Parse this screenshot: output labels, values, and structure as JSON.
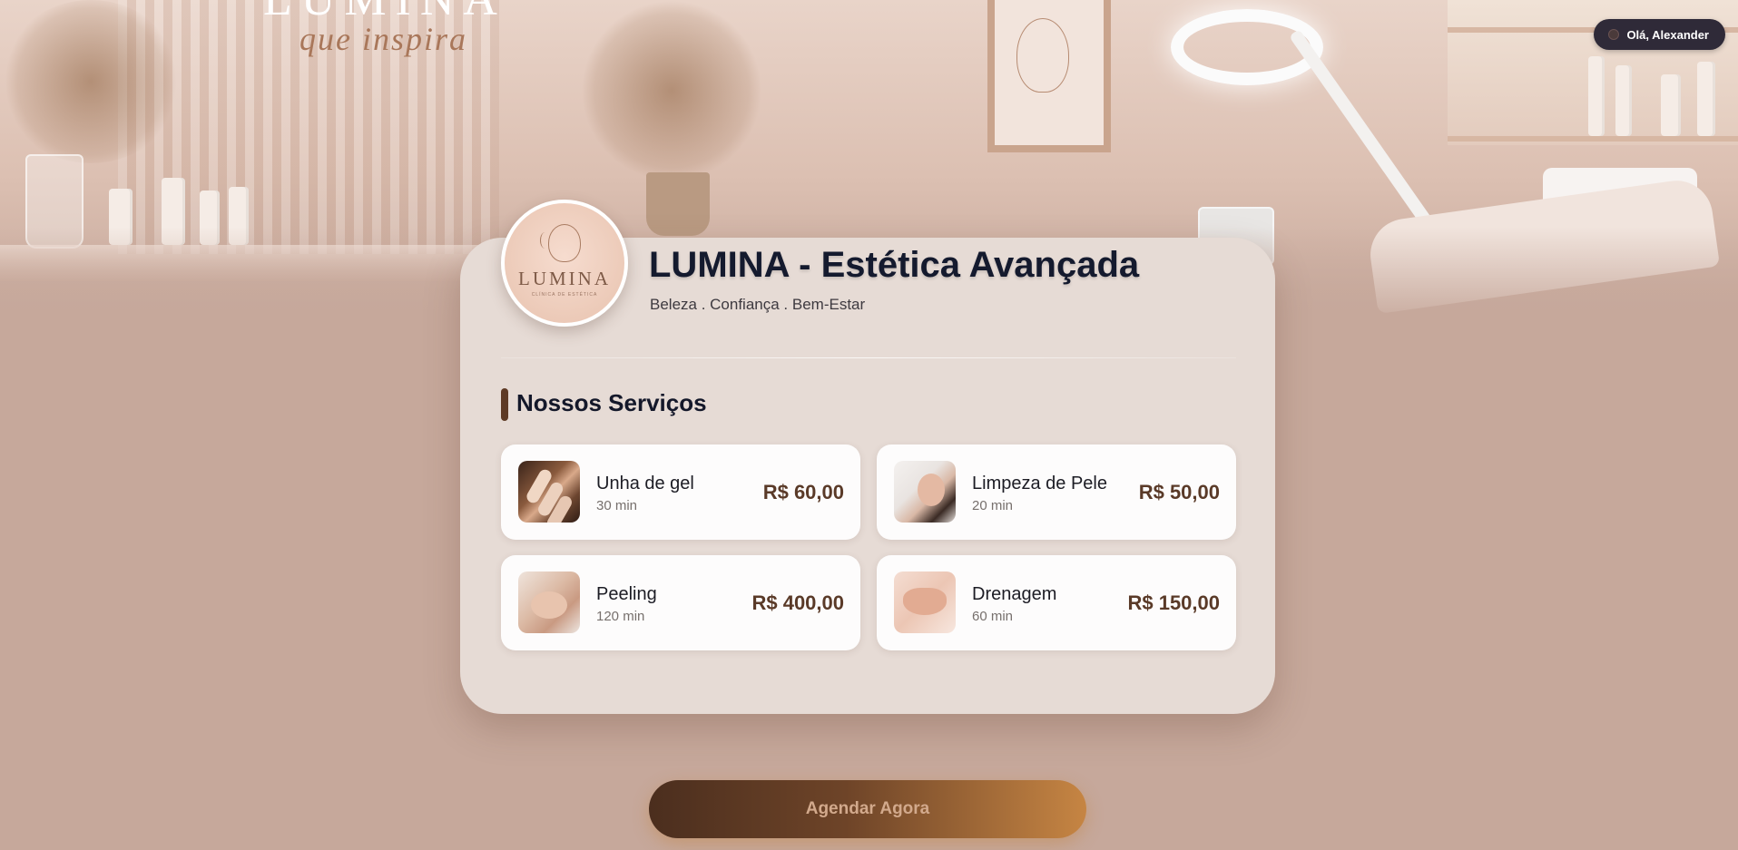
{
  "header": {
    "greeting": "Olá, Alexander"
  },
  "background": {
    "sign_script": "que inspira",
    "sign_top": "LUMINA"
  },
  "clinic": {
    "logo_word": "LUMINA",
    "logo_sub": "CLÍNICA DE ESTÉTICA",
    "title": "LUMINA - Estética Avançada",
    "tagline": "Beleza . Confiança . Bem-Estar"
  },
  "services_section": {
    "title": "Nossos Serviços",
    "items": [
      {
        "name": "Unha de gel",
        "duration": "30 min",
        "price": "R$ 60,00",
        "icon": "nails-photo"
      },
      {
        "name": "Limpeza de Pele",
        "duration": "20 min",
        "price": "R$ 50,00",
        "icon": "facial-cleansing-photo"
      },
      {
        "name": "Peeling",
        "duration": "120 min",
        "price": "R$ 400,00",
        "icon": "peeling-photo"
      },
      {
        "name": "Drenagem",
        "duration": "60 min",
        "price": "R$ 150,00",
        "icon": "drainage-photo"
      }
    ]
  },
  "cta": {
    "label": "Agendar Agora"
  },
  "colors": {
    "page_bg": "#c6a89b",
    "card_bg": "#e6dbd5",
    "accent_dark": "#5e3a25",
    "accent_gold": "#c68543",
    "title_text": "#141a2e"
  }
}
